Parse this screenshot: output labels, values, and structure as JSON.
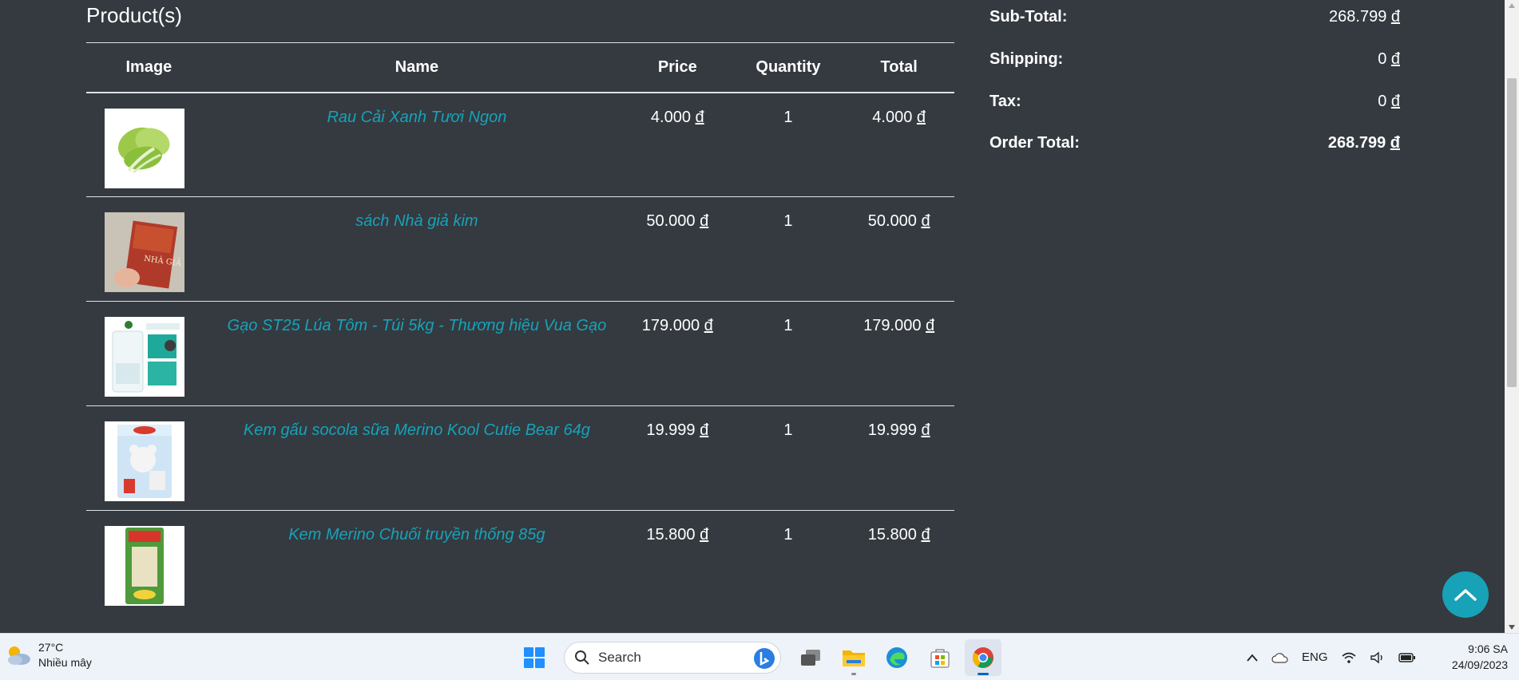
{
  "products": {
    "heading": "Product(s)",
    "columns": {
      "image": "Image",
      "name": "Name",
      "price": "Price",
      "quantity": "Quantity",
      "total": "Total"
    },
    "currency": "đ",
    "items": [
      {
        "name": "Rau Cải Xanh Tươi Ngon",
        "price": "4.000",
        "quantity": "1",
        "total": "4.000",
        "image_icon": "bok-choy-image"
      },
      {
        "name": "sách Nhà giả kim",
        "price": "50.000",
        "quantity": "1",
        "total": "50.000",
        "image_icon": "book-image",
        "image_text": "NHÀ GIẢ KIM"
      },
      {
        "name": "Gạo ST25 Lúa Tôm - Túi 5kg - Thương hiệu Vua Gạo",
        "price": "179.000",
        "quantity": "1",
        "total": "179.000",
        "image_icon": "rice-bag-image"
      },
      {
        "name": "Kem gấu socola sữa Merino Kool Cutie Bear 64g",
        "price": "19.999",
        "quantity": "1",
        "total": "19.999",
        "image_icon": "ice-cream-bear-image"
      },
      {
        "name": "Kem Merino Chuối truyền thống 85g",
        "price": "15.800",
        "quantity": "1",
        "total": "15.800",
        "image_icon": "banana-ice-cream-image"
      }
    ]
  },
  "summary": {
    "sub_total_label": "Sub-Total:",
    "sub_total_value": "268.799",
    "shipping_label": "Shipping:",
    "shipping_value": "0",
    "tax_label": "Tax:",
    "tax_value": "0",
    "order_total_label": "Order Total:",
    "order_total_value": "268.799",
    "currency": "đ"
  },
  "back_to_top_icon": "chevron-up-icon",
  "taskbar": {
    "weather_temp": "27°C",
    "weather_desc": "Nhiều mây",
    "search_placeholder": "Search",
    "language": "ENG",
    "time": "9:06 SA",
    "date": "24/09/2023"
  },
  "colors": {
    "page_bg": "#343a40",
    "link": "#17a2b8",
    "accent": "#17a2b8",
    "taskbar_bg": "#eef3f9"
  }
}
